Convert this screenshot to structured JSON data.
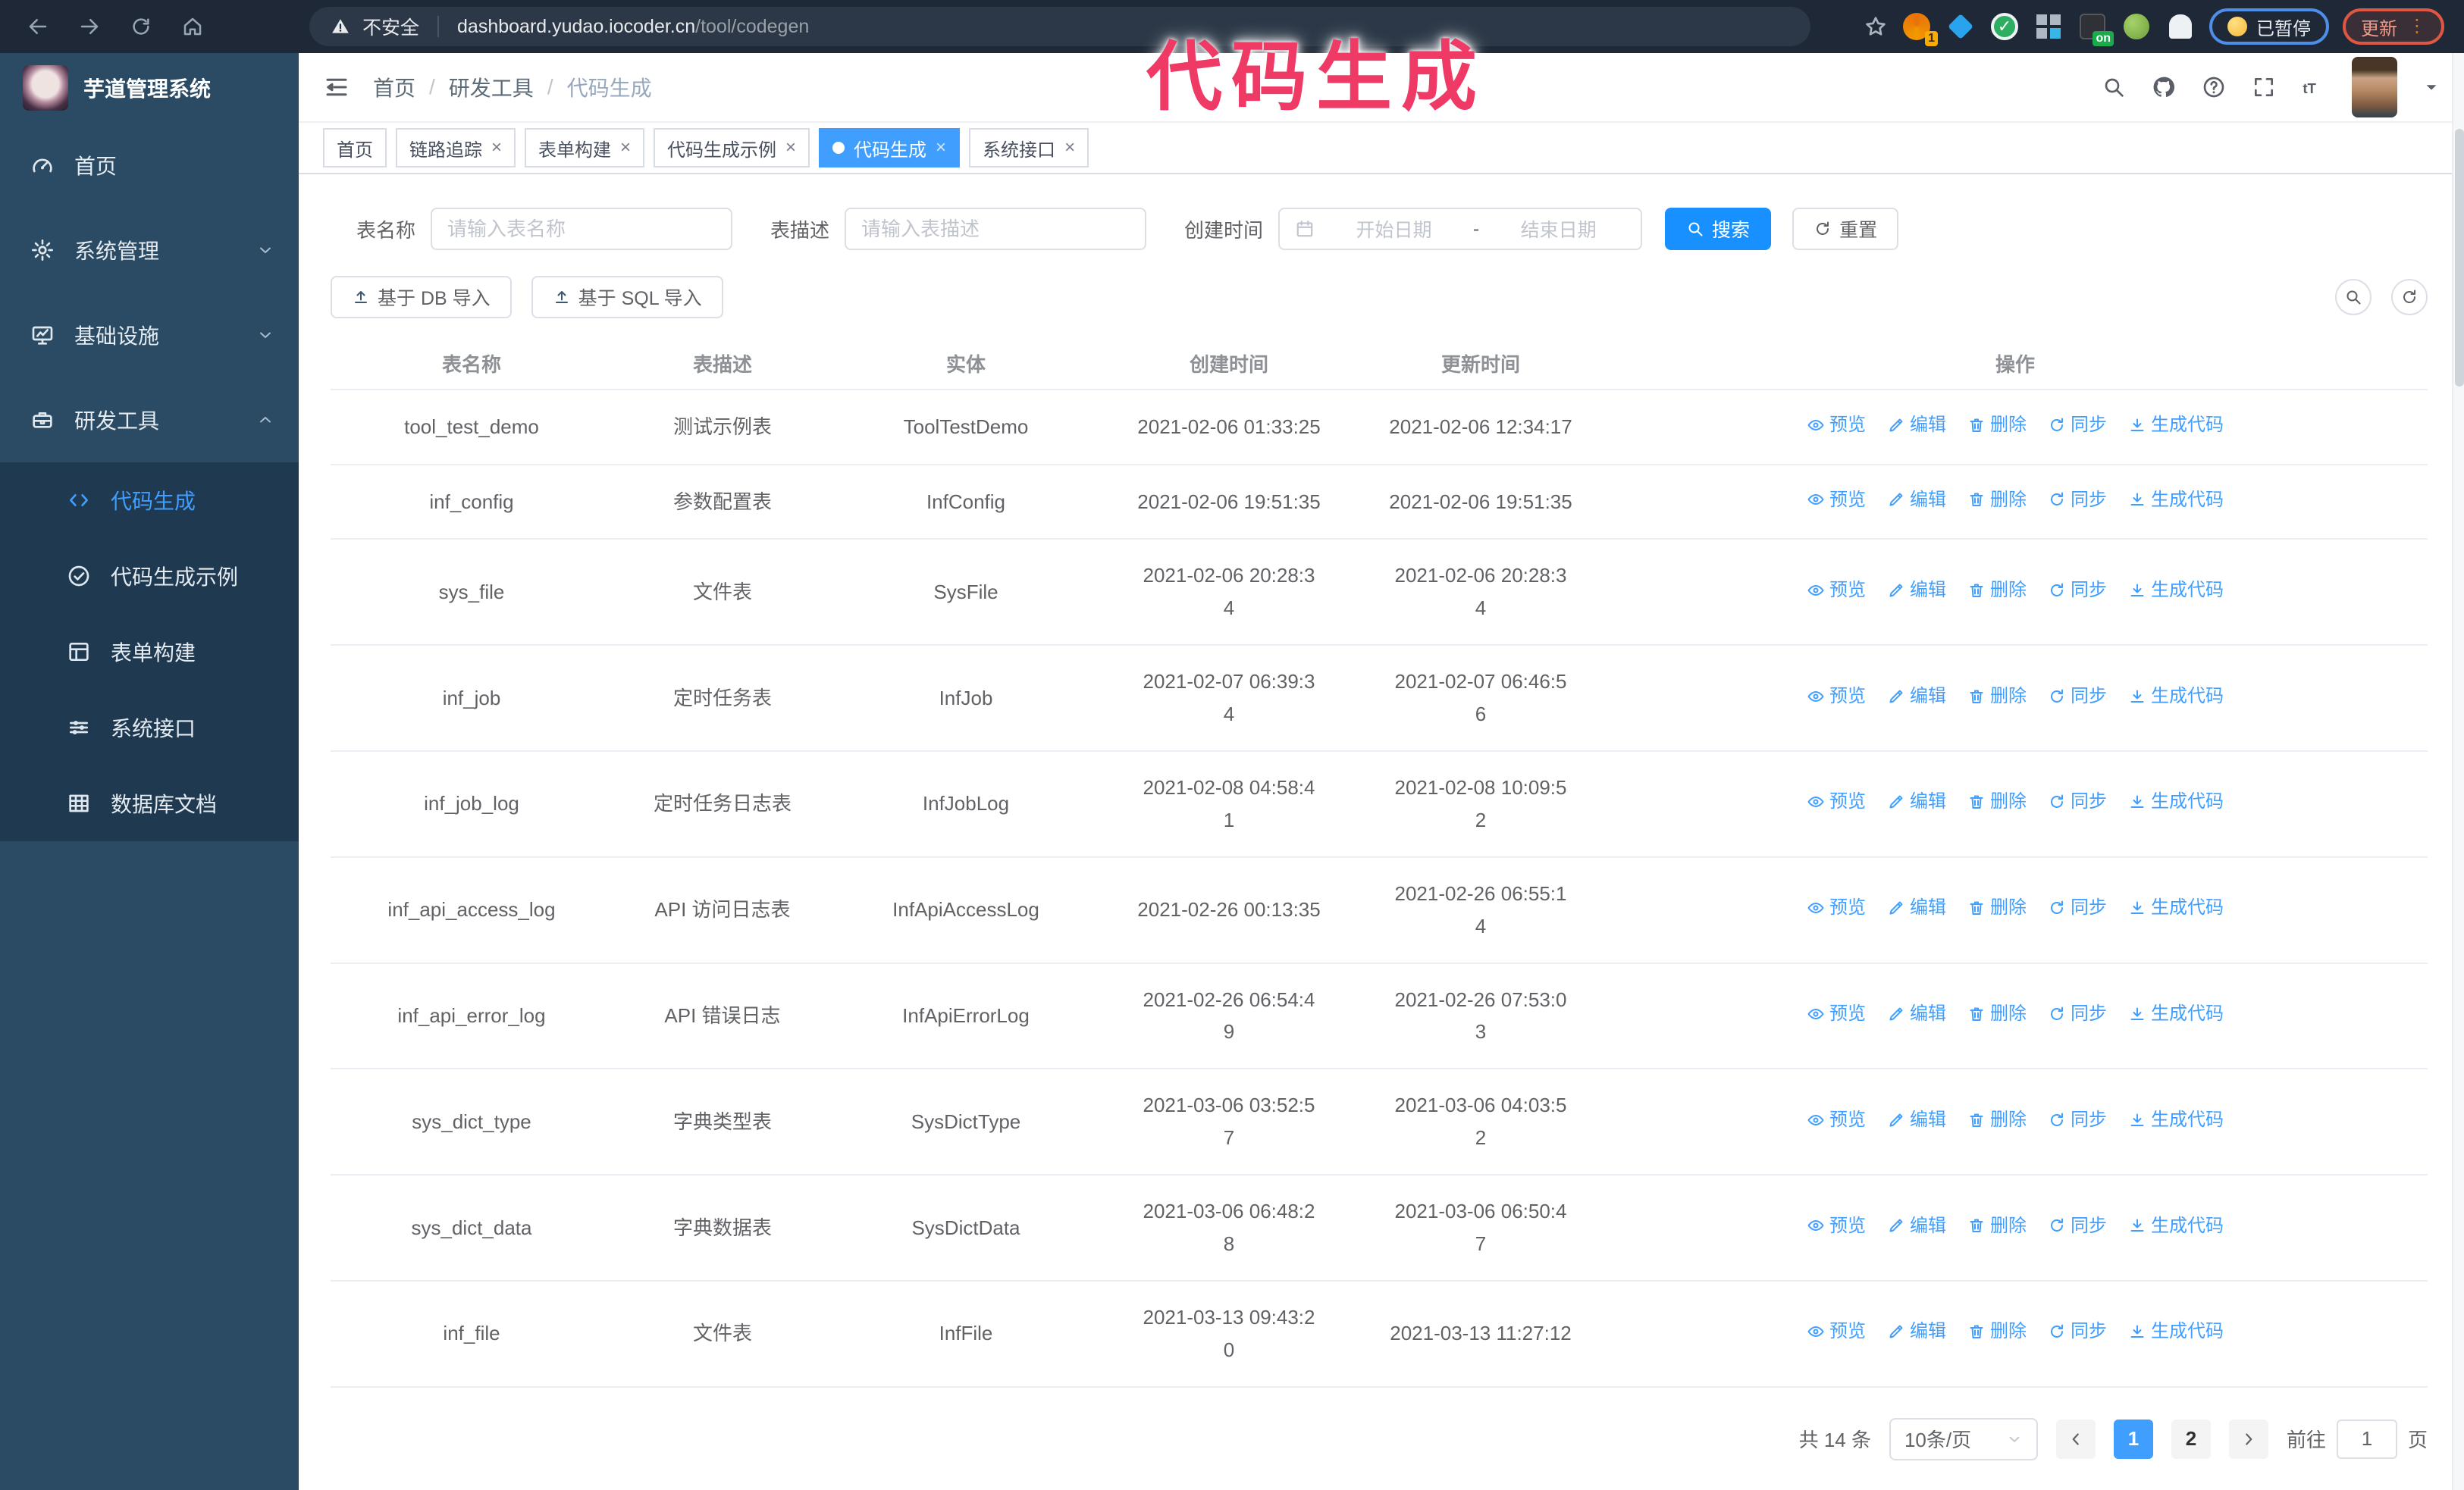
{
  "colors": {
    "accent": "#409eff",
    "primary": "#1890ff",
    "link": "#409eff",
    "annotation": "#ee3a64",
    "chrome": "#1e2836",
    "sidebar": "#2b4a63",
    "sidebar_sub": "#1f3951"
  },
  "annotation": {
    "text": "代码生成"
  },
  "browser": {
    "insecure_label": "不安全",
    "url_host": "dashboard.yudao.iocoder.cn",
    "url_path": "/tool/codegen",
    "extension_badge_count": "1",
    "extension_badge_on": "on",
    "paused_label": "已暂停",
    "update_label": "更新",
    "update_dots": "⋮"
  },
  "sidebar": {
    "title": "芋道管理系统",
    "items": [
      {
        "id": "home",
        "label": "首页",
        "icon": "dashboard",
        "chevron": null,
        "expanded": false
      },
      {
        "id": "system",
        "label": "系统管理",
        "icon": "gear",
        "chevron": "down",
        "expanded": false
      },
      {
        "id": "infra",
        "label": "基础设施",
        "icon": "monitor",
        "chevron": "down",
        "expanded": false
      },
      {
        "id": "devtools",
        "label": "研发工具",
        "icon": "toolbox",
        "chevron": "up",
        "expanded": true
      }
    ],
    "submenu": [
      {
        "id": "codegen",
        "label": "代码生成",
        "icon": "code",
        "active": true
      },
      {
        "id": "codegen-example",
        "label": "代码生成示例",
        "icon": "check-circle",
        "active": false
      },
      {
        "id": "form-builder",
        "label": "表单构建",
        "icon": "form",
        "active": false
      },
      {
        "id": "system-api",
        "label": "系统接口",
        "icon": "sliders",
        "active": false
      },
      {
        "id": "db-doc",
        "label": "数据库文档",
        "icon": "grid",
        "active": false
      }
    ]
  },
  "navbar": {
    "breadcrumb": [
      "首页",
      "研发工具",
      "代码生成"
    ]
  },
  "tabs": [
    {
      "id": "home",
      "label": "首页",
      "closable": false,
      "active": false
    },
    {
      "id": "trace",
      "label": "链路追踪",
      "closable": true,
      "active": false
    },
    {
      "id": "form-builder",
      "label": "表单构建",
      "closable": true,
      "active": false
    },
    {
      "id": "codegen-example",
      "label": "代码生成示例",
      "closable": true,
      "active": false
    },
    {
      "id": "codegen",
      "label": "代码生成",
      "closable": true,
      "active": true
    },
    {
      "id": "system-api",
      "label": "系统接口",
      "closable": true,
      "active": false
    }
  ],
  "filters": {
    "table_name_label": "表名称",
    "table_name_placeholder": "请输入表名称",
    "table_desc_label": "表描述",
    "table_desc_placeholder": "请输入表描述",
    "create_time_label": "创建时间",
    "date_start_placeholder": "开始日期",
    "date_separator": "-",
    "date_end_placeholder": "结束日期",
    "search_label": "搜索",
    "reset_label": "重置"
  },
  "toolbar": {
    "import_db_label": "基于 DB 导入",
    "import_sql_label": "基于 SQL 导入"
  },
  "table": {
    "columns": [
      "表名称",
      "表描述",
      "实体",
      "创建时间",
      "更新时间",
      "操作"
    ],
    "actions": [
      {
        "id": "preview",
        "icon": "eye",
        "label": "预览"
      },
      {
        "id": "edit",
        "icon": "edit",
        "label": "编辑"
      },
      {
        "id": "delete",
        "icon": "trash",
        "label": "删除"
      },
      {
        "id": "sync",
        "icon": "sync",
        "label": "同步"
      },
      {
        "id": "generate",
        "icon": "download",
        "label": "生成代码"
      }
    ],
    "rows": [
      {
        "name": "tool_test_demo",
        "desc": "测试示例表",
        "entity": "ToolTestDemo",
        "created": "2021-02-06 01:33:25",
        "updated": "2021-02-06 12:34:17"
      },
      {
        "name": "inf_config",
        "desc": "参数配置表",
        "entity": "InfConfig",
        "created": "2021-02-06 19:51:35",
        "updated": "2021-02-06 19:51:35"
      },
      {
        "name": "sys_file",
        "desc": "文件表",
        "entity": "SysFile",
        "created": "2021-02-06 20:28:3\n4",
        "updated": "2021-02-06 20:28:3\n4"
      },
      {
        "name": "inf_job",
        "desc": "定时任务表",
        "entity": "InfJob",
        "created": "2021-02-07 06:39:3\n4",
        "updated": "2021-02-07 06:46:5\n6"
      },
      {
        "name": "inf_job_log",
        "desc": "定时任务日志表",
        "entity": "InfJobLog",
        "created": "2021-02-08 04:58:4\n1",
        "updated": "2021-02-08 10:09:5\n2"
      },
      {
        "name": "inf_api_access_log",
        "desc": "API 访问日志表",
        "entity": "InfApiAccessLog",
        "created": "2021-02-26 00:13:35",
        "updated": "2021-02-26 06:55:1\n4"
      },
      {
        "name": "inf_api_error_log",
        "desc": "API 错误日志",
        "entity": "InfApiErrorLog",
        "created": "2021-02-26 06:54:4\n9",
        "updated": "2021-02-26 07:53:0\n3"
      },
      {
        "name": "sys_dict_type",
        "desc": "字典类型表",
        "entity": "SysDictType",
        "created": "2021-03-06 03:52:5\n7",
        "updated": "2021-03-06 04:03:5\n2"
      },
      {
        "name": "sys_dict_data",
        "desc": "字典数据表",
        "entity": "SysDictData",
        "created": "2021-03-06 06:48:2\n8",
        "updated": "2021-03-06 06:50:4\n7"
      },
      {
        "name": "inf_file",
        "desc": "文件表",
        "entity": "InfFile",
        "created": "2021-03-13 09:43:2\n0",
        "updated": "2021-03-13 11:27:12"
      }
    ]
  },
  "pagination": {
    "total_text": "共 14 条",
    "page_size": "10条/页",
    "pages": [
      "1",
      "2"
    ],
    "active_page": "1",
    "goto_label": "前往",
    "goto_value": "1",
    "goto_unit": "页"
  }
}
